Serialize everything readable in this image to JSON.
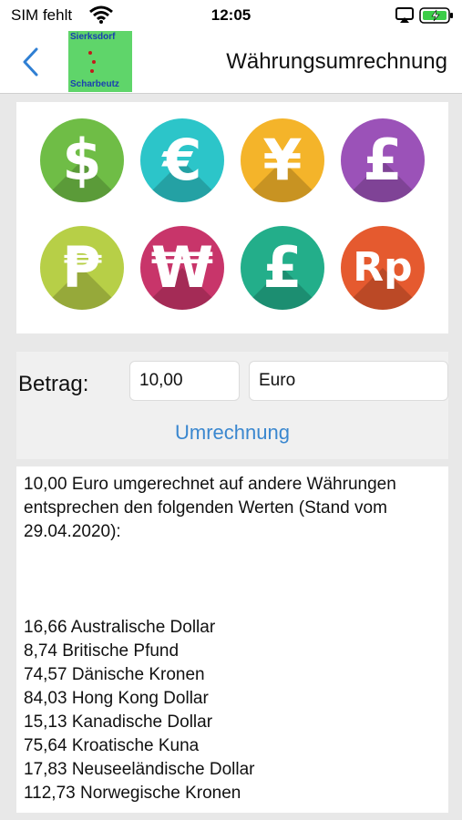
{
  "status": {
    "carrier": "SIM fehlt",
    "time": "12:05"
  },
  "nav": {
    "title": "Währungsumrechnung",
    "logo_top": "Sierksdorf",
    "logo_bottom": "Scharbeutz"
  },
  "currencies": [
    {
      "symbol": "$",
      "name": "dollar-icon",
      "color": "#6fbd46"
    },
    {
      "symbol": "€",
      "name": "euro-icon",
      "color": "#2cc5c9"
    },
    {
      "symbol": "¥",
      "name": "yen-icon",
      "color": "#f4b42a"
    },
    {
      "symbol": "£",
      "name": "pound-icon",
      "color": "#9b52b8"
    },
    {
      "symbol": "₱",
      "name": "peso-icon",
      "color": "#b7cf47"
    },
    {
      "symbol": "₩",
      "name": "won-icon",
      "color": "#c8356a"
    },
    {
      "symbol": "£",
      "name": "pound-icon",
      "color": "#23ae8a"
    },
    {
      "symbol": "Rp",
      "name": "rupiah-icon",
      "color": "#e55a2f"
    }
  ],
  "form": {
    "amount_label": "Betrag:",
    "amount_value": "10,00",
    "currency_value": "Euro",
    "convert_label": "Umrechnung"
  },
  "result": {
    "intro": "10,00 Euro umgerechnet auf andere Währungen entsprechen den folgenden Werten (Stand vom 29.04.2020):",
    "rows": [
      "16,66 Australische Dollar",
      "8,74 Britische Pfund",
      "74,57 Dänische Kronen",
      "84,03 Hong Kong Dollar",
      "15,13 Kanadische Dollar",
      "75,64 Kroatische Kuna",
      "17,83 Neuseeländische Dollar",
      "112,73 Norwegische Kronen"
    ]
  }
}
